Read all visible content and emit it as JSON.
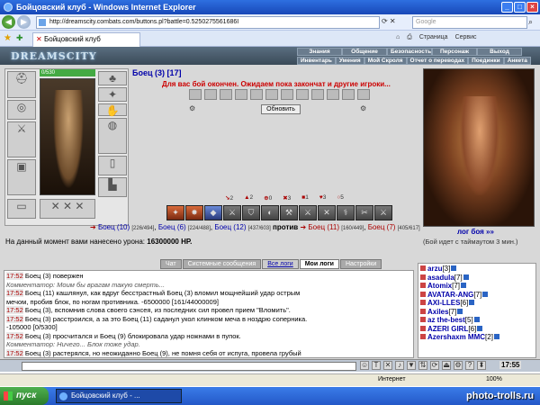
{
  "window": {
    "title": "Бойцовский клуб - Windows Internet Explorer"
  },
  "address": {
    "url": "http://dreamscity.combats.com/buttons.pl?battle=0.5250275561686I",
    "search_placeholder": "Google"
  },
  "tabs": {
    "active_label": "Бойцовский клуб",
    "page_menu": "Страница",
    "tools_menu": "Сервис"
  },
  "game": {
    "logo": "DREAMSCITY",
    "menu_top": [
      "Знания",
      "Общение",
      "Безопасность",
      "Персонаж",
      "Выход"
    ],
    "menu_bottom": [
      "Инвентарь",
      "Умения",
      "Мой Скроля",
      "Отчет о переводах",
      "Поединки",
      "Анкета"
    ],
    "hp": "0/530",
    "player": {
      "name": "Боец",
      "level": "(3)",
      "extra": "[17]"
    },
    "fight_message": "Для вас бой окончен. Ожидаем пока закончат и другие игроки...",
    "refresh_label": "Обновить",
    "stats": [
      "2",
      "2",
      "0",
      "3",
      "1",
      "3",
      "5"
    ],
    "enemy_label": "лог боя »»",
    "fighters": {
      "blue": [
        {
          "name": "Боец",
          "level": "(10)",
          "hp": "[226/494]"
        },
        {
          "name": "Боец",
          "level": "(6)",
          "hp": "[224/488]"
        },
        {
          "name": "Боец",
          "level": "(12)",
          "hp": "[437/603]"
        }
      ],
      "vs": "против",
      "red": [
        {
          "name": "Боец",
          "level": "(11)",
          "hp": "[160/449]"
        },
        {
          "name": "Боец",
          "level": "(7)",
          "hp": "[405/617]"
        }
      ]
    },
    "damage_text": "На данный момент вами нанесено урона:",
    "damage_value": "16300000 HP.",
    "timeout_text": "(Бой идет с таймаутом 3 мин.)",
    "log_tabs": [
      "Чат",
      "Системные сообщения",
      "Все логи",
      "Мои логи",
      "Настройки"
    ]
  },
  "log": [
    {
      "time": "17:52",
      "text": "Боец (3) повержен"
    },
    {
      "time": "",
      "text": "Комментатор: Моим бы врагам такую смерть..."
    },
    {
      "time": "17:52",
      "text": "Боец (11) кашлянул, как вдруг бесстрастный Боец (3) вломил мощнейший удар острым"
    },
    {
      "time": "",
      "text": "мечом, пробив блок, по ногам противника. -6500000 [161/44000009]"
    },
    {
      "time": "17:52",
      "text": "Боец (3), вспомнив слова своего сэнсея, из последних сил провел прием \"Вломить\"."
    },
    {
      "time": "17:52",
      "text": "Боец (3) расстроился, а за это Боец (11) саданул укол клинком меча в ноздрю соперника."
    },
    {
      "time": "",
      "text": "-105000 [0/5300]"
    },
    {
      "time": "17:52",
      "text": "Боец (3) просчитался и Боец (9) блокировала удар ножнами в пупок."
    },
    {
      "time": "",
      "text": "Комментатор: Ничего... Блок тоже удар."
    },
    {
      "time": "17:52",
      "text": "Боец (3) растерялся, но неожиданно Боец (9), не помня себя от испуга, провела грубый"
    }
  ],
  "players": [
    {
      "name": "arzu",
      "level": "[3]"
    },
    {
      "name": "asadula",
      "level": "[7]"
    },
    {
      "name": "Atomix",
      "level": "[7]"
    },
    {
      "name": "AVATAR-ANG",
      "level": "[7]"
    },
    {
      "name": "AXI-LLES",
      "level": "[6]"
    },
    {
      "name": "Axiles",
      "level": "[7]"
    },
    {
      "name": "az the-best",
      "level": "[5]"
    },
    {
      "name": "AZERI GIRL",
      "level": "[6]"
    },
    {
      "name": "Azershaxm MMC",
      "level": "[2]"
    }
  ],
  "chat": {
    "clock": "17:55"
  },
  "status": {
    "zone": "Интернет",
    "zoom": "100%"
  },
  "taskbar": {
    "start": "пуск",
    "task": "Бойцовский клуб - ..."
  },
  "watermark": "photo-trolls.ru",
  "colors": {
    "accent": "#2458c8",
    "log_red": "#c00000",
    "player_blue": "#0000aa"
  }
}
